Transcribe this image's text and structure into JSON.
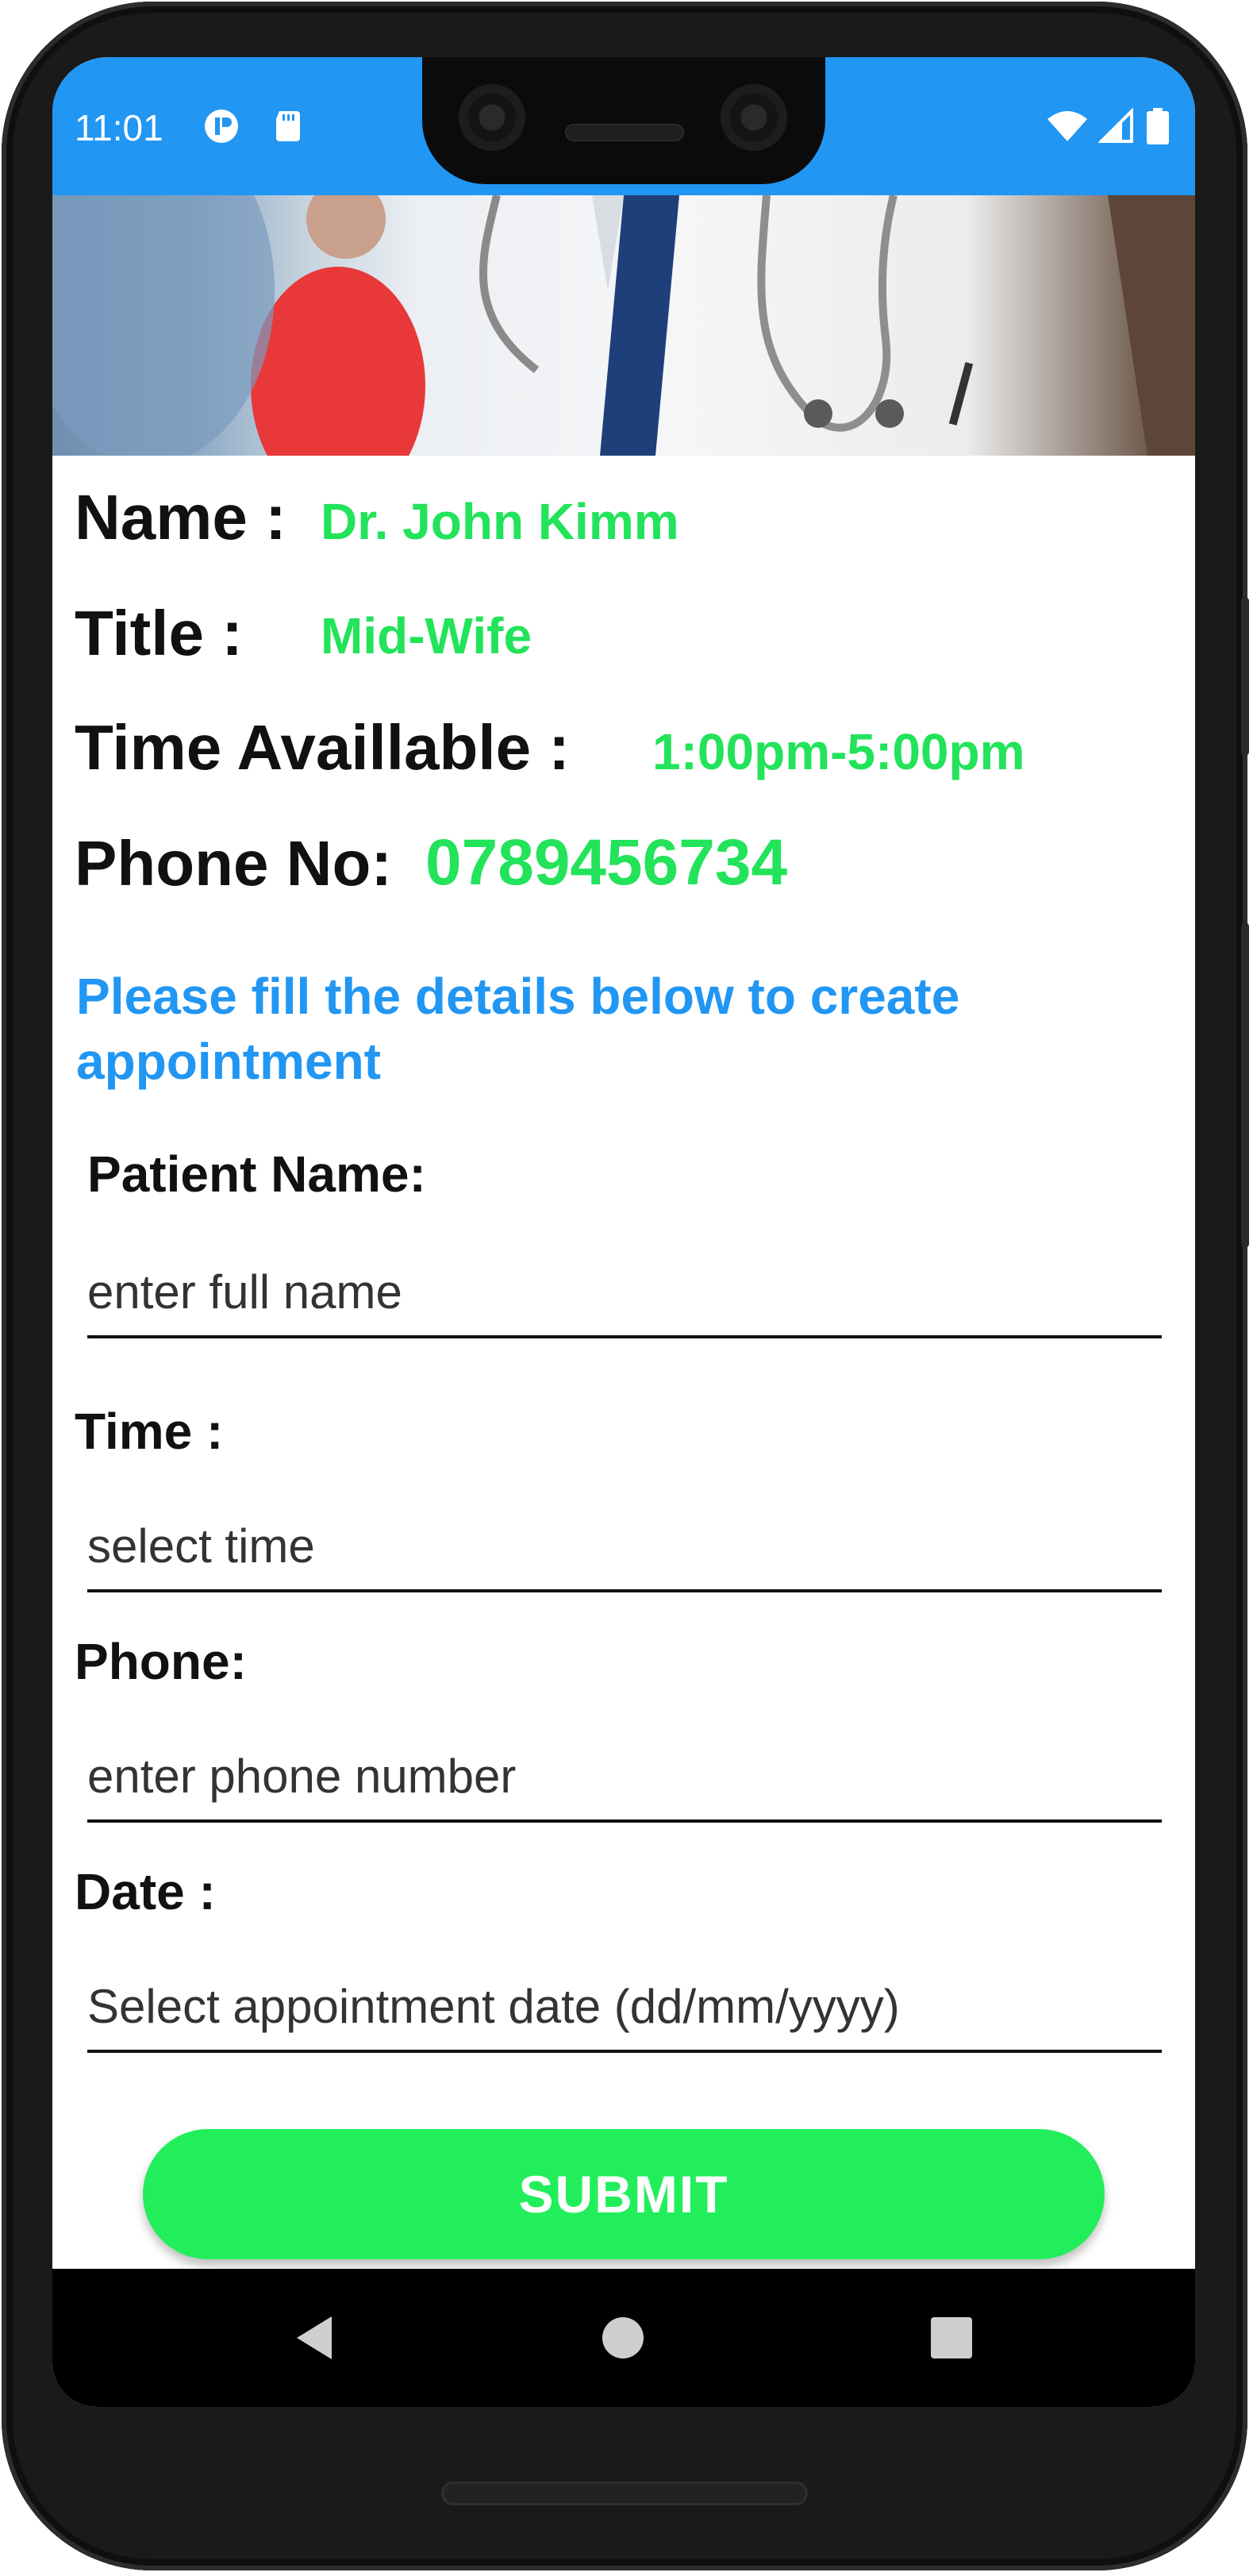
{
  "status_bar": {
    "time": "11:01",
    "left_icons": [
      "app-notification-icon",
      "sd-card-icon"
    ],
    "right_icons": [
      "wifi-icon",
      "cell-signal-icon",
      "battery-icon"
    ],
    "background_color": "#2196f3"
  },
  "doctor": {
    "name_label": "Name :",
    "name_value": "Dr. John Kimm",
    "title_label": "Title :",
    "title_value": "Mid-Wife",
    "time_label": "Time Availlable :",
    "time_value": "1:00pm-5:00pm",
    "phone_label": "Phone No:",
    "phone_value": "0789456734"
  },
  "instructions": "Please fill the details below to create appointment",
  "form": {
    "patient_name_label": "Patient Name:",
    "patient_name_placeholder": "enter full name",
    "time_label": "Time :",
    "time_placeholder": "select time",
    "phone_label": "Phone:",
    "phone_placeholder": "enter phone number",
    "date_label": "Date :",
    "date_placeholder": "Select appointment date (dd/mm/yyyy)",
    "submit_label": "SUBMIT"
  },
  "nav_bar": {
    "icons": [
      "back-icon",
      "home-icon",
      "recents-icon"
    ]
  },
  "colors": {
    "accent_blue": "#2196f3",
    "accent_green": "#22e35a",
    "button_green": "#22ee5c"
  }
}
